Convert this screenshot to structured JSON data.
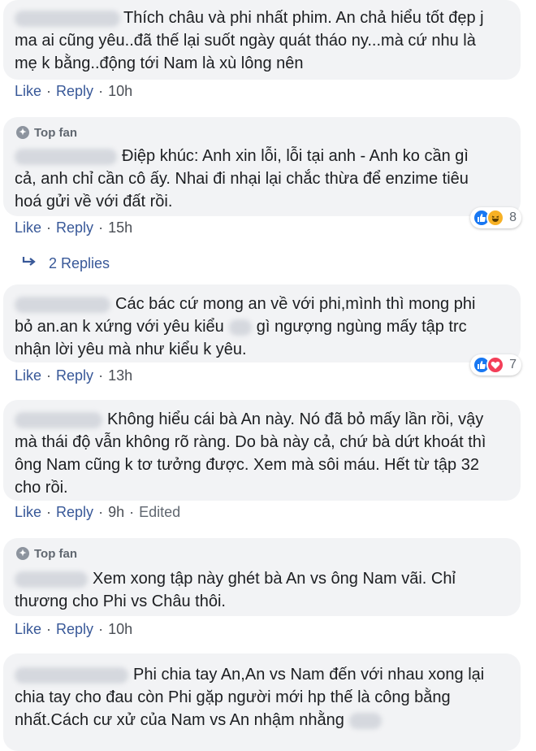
{
  "comments": [
    {
      "top_fan": false,
      "lines": [
        "Thích châu và phi nhất phim. An chả hiểu tốt đẹp j",
        "ma ai cũng yêu..đã thế lại suốt ngày quát tháo ny...mà cứ nhu là",
        "mẹ k bằng..động tới Nam là xù lông nên"
      ],
      "like": "Like",
      "reply": "Reply",
      "time": "10h"
    },
    {
      "top_fan": true,
      "top_fan_label": "Top fan",
      "lines": [
        "Điệp khúc: Anh xin lỗi, lỗi tại anh - Anh ko cần gì",
        "cả, anh chỉ cần cô ấy. Nhai đi nhại lại chắc thừa để enzime tiêu",
        "hoá gửi về với đất rồi."
      ],
      "like": "Like",
      "reply": "Reply",
      "time": "15h",
      "reactions": {
        "icons": [
          "like",
          "haha"
        ],
        "count": "8"
      }
    },
    {
      "top_fan": false,
      "lines": [
        "Các bác cứ mong an về với phi,mình thì mong phi",
        "bỏ an.an k xứng với yêu kiểu",
        "gì ngượng ngùng mấy tập trc",
        "nhận lời yêu mà như kiểu k yêu."
      ],
      "like": "Like",
      "reply": "Reply",
      "time": "13h",
      "reactions": {
        "icons": [
          "like",
          "love"
        ],
        "count": "7"
      }
    },
    {
      "top_fan": false,
      "lines": [
        "Không hiểu cái bà An này. Nó đã bỏ mấy lần rồi, vậy",
        "mà thái độ vẫn không rõ ràng. Do bà này cả, chứ bà dứt khoát thì",
        "ông Nam cũng k tơ tưởng được. Xem mà sôi máu. Hết từ tập 32",
        "cho rồi."
      ],
      "like": "Like",
      "reply": "Reply",
      "time": "9h",
      "edited": "Edited"
    },
    {
      "top_fan": true,
      "top_fan_label": "Top fan",
      "lines": [
        "Xem xong tập này ghét bà An vs ông Nam vãi. Chỉ",
        "thương cho Phi vs Châu thôi."
      ],
      "like": "Like",
      "reply": "Reply",
      "time": "10h"
    },
    {
      "top_fan": false,
      "lines": [
        "Phi chia tay An,An vs Nam đến với nhau xong lại",
        "chia tay cho đau còn Phi gặp người mới hp thế là công bằng",
        "nhất.Cách cư xử của Nam vs An nhậm nhằng"
      ]
    }
  ],
  "replies_link": {
    "label": "2 Replies",
    "icon": "reply-arrow-icon"
  },
  "colors": {
    "bubble": "#f2f3f5",
    "link": "#385898",
    "meta": "#4b4f56",
    "like_reaction": "#1877f2",
    "haha_reaction": "#f7b125",
    "love_reaction": "#f33e58"
  }
}
